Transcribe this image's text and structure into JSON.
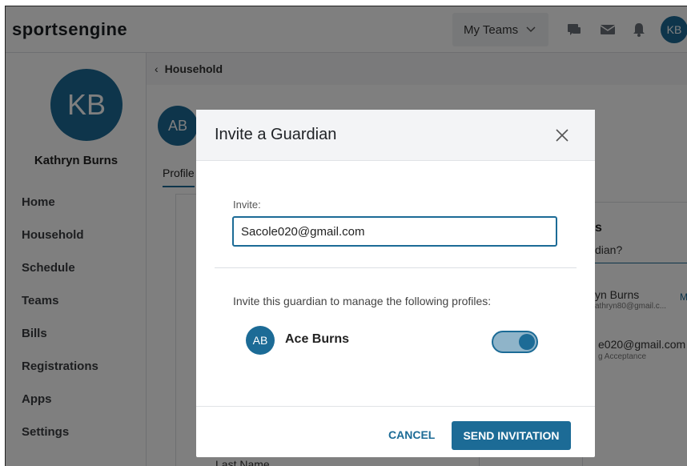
{
  "header": {
    "logo_text": "sportsengine",
    "my_teams_label": "My Teams",
    "user_initials": "KB",
    "icons": [
      "chat-icon",
      "mail-icon",
      "bell-icon",
      "chevron-down-icon"
    ]
  },
  "sidebar": {
    "avatar_initials": "KB",
    "user_name": "Kathryn Burns",
    "items": [
      {
        "label": "Home"
      },
      {
        "label": "Household"
      },
      {
        "label": "Schedule"
      },
      {
        "label": "Teams"
      },
      {
        "label": "Bills"
      },
      {
        "label": "Registrations"
      },
      {
        "label": "Apps"
      },
      {
        "label": "Settings"
      }
    ]
  },
  "main": {
    "breadcrumb": "Household",
    "profile_initials": "AB",
    "tab_profile": "Profile",
    "background_field_label": "Last Name",
    "right_panel": {
      "heading_fragment": "s",
      "question_fragment": "dian?",
      "guardian1_name": "yn Burns",
      "guardian1_email": "athryn80@gmail.c...",
      "guardian1_action": "M",
      "guardian2_email": "e020@gmail.com",
      "guardian2_status": "g Acceptance"
    }
  },
  "modal": {
    "title": "Invite a Guardian",
    "invite_label": "Invite:",
    "invite_value": "Sacole020@gmail.com",
    "manage_text": "Invite this guardian to manage the following profiles:",
    "profile": {
      "initials": "AB",
      "name": "Ace Burns",
      "toggle_on": true
    },
    "cancel_label": "CANCEL",
    "send_label": "SEND INVITATION"
  },
  "colors": {
    "accent": "#1c6b96",
    "toggle_track": "#8fb4c9",
    "overlay": "#000000"
  }
}
